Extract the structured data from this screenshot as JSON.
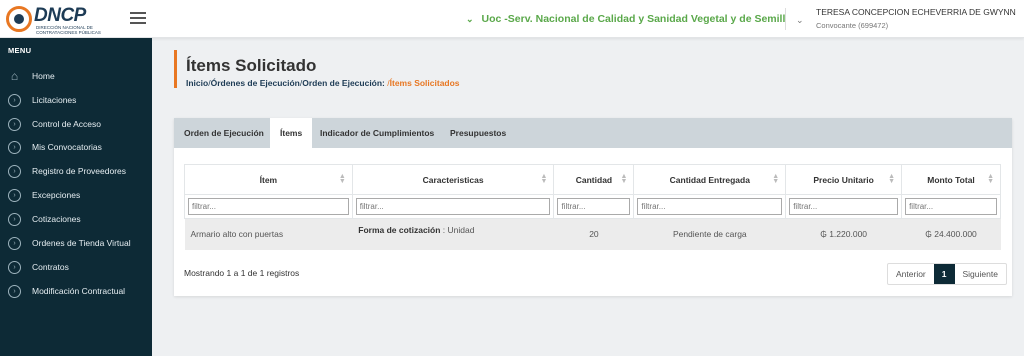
{
  "header": {
    "logo_text": "DNCP",
    "logo_sub": "DIRECCIÓN NACIONAL DE CONTRATACIONES PÚBLICAS",
    "unit": "Uoc -Serv. Nacional de Calidad y Sanidad Vegetal y de Semill",
    "user_name": "TERESA CONCEPCION ECHEVERRIA DE GWYNN",
    "user_role": "Convocante (699472)"
  },
  "sidebar": {
    "title": "MENU",
    "items": [
      {
        "label": "Home",
        "icon": "home-icon"
      },
      {
        "label": "Licitaciones",
        "icon": "circle-chevron-icon"
      },
      {
        "label": "Control de Acceso",
        "icon": "circle-chevron-icon"
      },
      {
        "label": "Mis Convocatorias",
        "icon": "circle-chevron-icon"
      },
      {
        "label": "Registro de Proveedores",
        "icon": "circle-chevron-icon"
      },
      {
        "label": "Excepciones",
        "icon": "circle-chevron-icon"
      },
      {
        "label": "Cotizaciones",
        "icon": "circle-chevron-icon"
      },
      {
        "label": "Ordenes de Tienda Virtual",
        "icon": "circle-chevron-icon"
      },
      {
        "label": "Contratos",
        "icon": "circle-chevron-icon"
      },
      {
        "label": "Modificación Contractual",
        "icon": "circle-chevron-icon"
      }
    ]
  },
  "page": {
    "title": "Ítems Solicitado",
    "breadcrumb": [
      "Inicio",
      "Órdenes de Ejecución",
      "Orden de Ejecución:",
      "Ítems Solicitados"
    ]
  },
  "tabs": [
    "Orden de Ejecución",
    "Ítems",
    "Indicador de Cumplimientos",
    "Presupuestos"
  ],
  "table": {
    "headers": [
      "Ítem",
      "Caracteristicas",
      "Cantidad",
      "Cantidad Entregada",
      "Precio Unitario",
      "Monto Total"
    ],
    "filter_placeholder": "filtrar...",
    "rows": [
      {
        "item": "Armario alto con puertas",
        "feature_label": "Forma de cotización",
        "feature_value": " : Unidad",
        "cantidad": "20",
        "entregada": "Pendiente de carga",
        "precio": "₲ 1.220.000",
        "monto": "₲ 24.400.000"
      }
    ]
  },
  "footer": {
    "info": "Mostrando 1 a 1 de 1 registros",
    "prev": "Anterior",
    "page": "1",
    "next": "Siguiente"
  },
  "colors": {
    "sidebar_bg": "#0d2a36",
    "accent": "#e87722",
    "unit_green": "#5aa84a"
  }
}
